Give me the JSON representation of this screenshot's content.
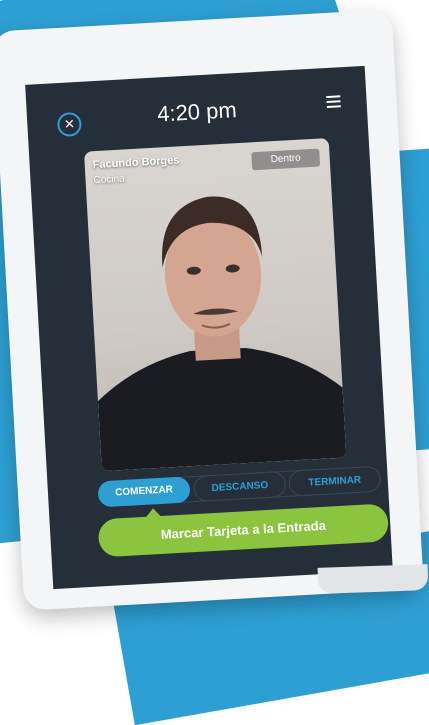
{
  "header": {
    "time": "4:20 pm",
    "close_glyph": "✕"
  },
  "employee": {
    "name": "Facundo Borges",
    "department": "Cocina",
    "status": "Dentro"
  },
  "actions": {
    "tabs": [
      {
        "label": "COMENZAR",
        "active": true
      },
      {
        "label": "DESCANSO",
        "active": false
      },
      {
        "label": "TERMINAR",
        "active": false
      }
    ],
    "primary_label": "Marcar Tarjeta a la Entrada"
  },
  "colors": {
    "accent_blue": "#2e9fd3",
    "screen_bg": "#242f3a",
    "action_green": "#8bc53f"
  },
  "icons": {
    "close": "close-icon",
    "menu": "menu-icon"
  }
}
